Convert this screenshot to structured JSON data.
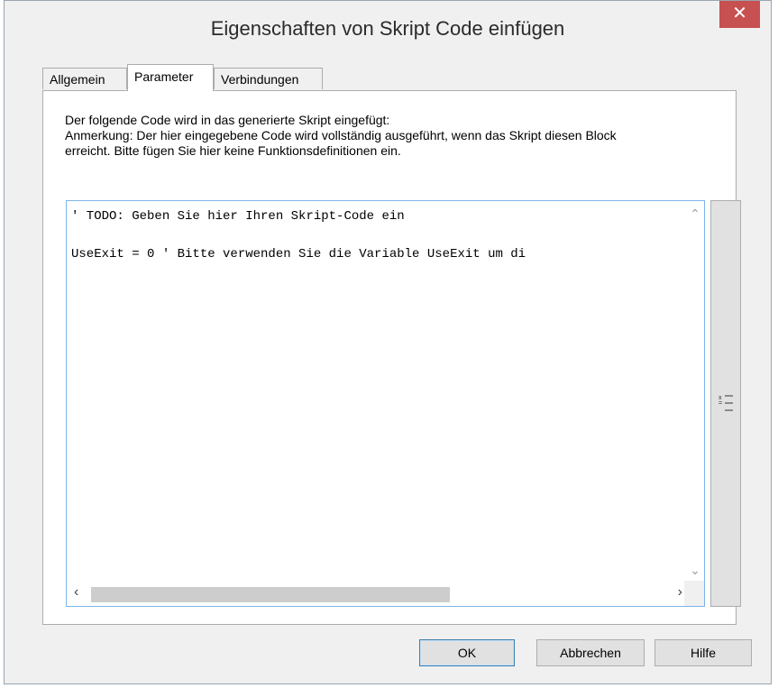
{
  "window": {
    "title": "Eigenschaften von Skript Code einfügen",
    "close_label": "✕"
  },
  "tabs": [
    {
      "label": "Allgemein",
      "active": false
    },
    {
      "label": "Parameter",
      "active": true
    },
    {
      "label": "Verbindungen",
      "active": false
    }
  ],
  "panel": {
    "description": "Der folgende Code wird in das generierte Skript eingefügt:\nAnmerkung: Der hier eingegebene Code wird vollständig ausgeführt, wenn das Skript diesen Block\nerreicht. Bitte fügen Sie hier keine Funktionsdefinitionen ein.",
    "code": "' TODO: Geben Sie hier Ihren Skript-Code ein\n\nUseExit = 0 ' Bitte verwenden Sie die Variable UseExit um di"
  },
  "buttons": {
    "ok": "OK",
    "cancel": "Abbrechen",
    "help": "Hilfe"
  },
  "icons": {
    "scroll_up": "chevron-up-icon",
    "scroll_down": "chevron-down-icon",
    "scroll_left": "chevron-left-icon",
    "scroll_right": "chevron-right-icon",
    "side": "insert-variable-icon"
  }
}
